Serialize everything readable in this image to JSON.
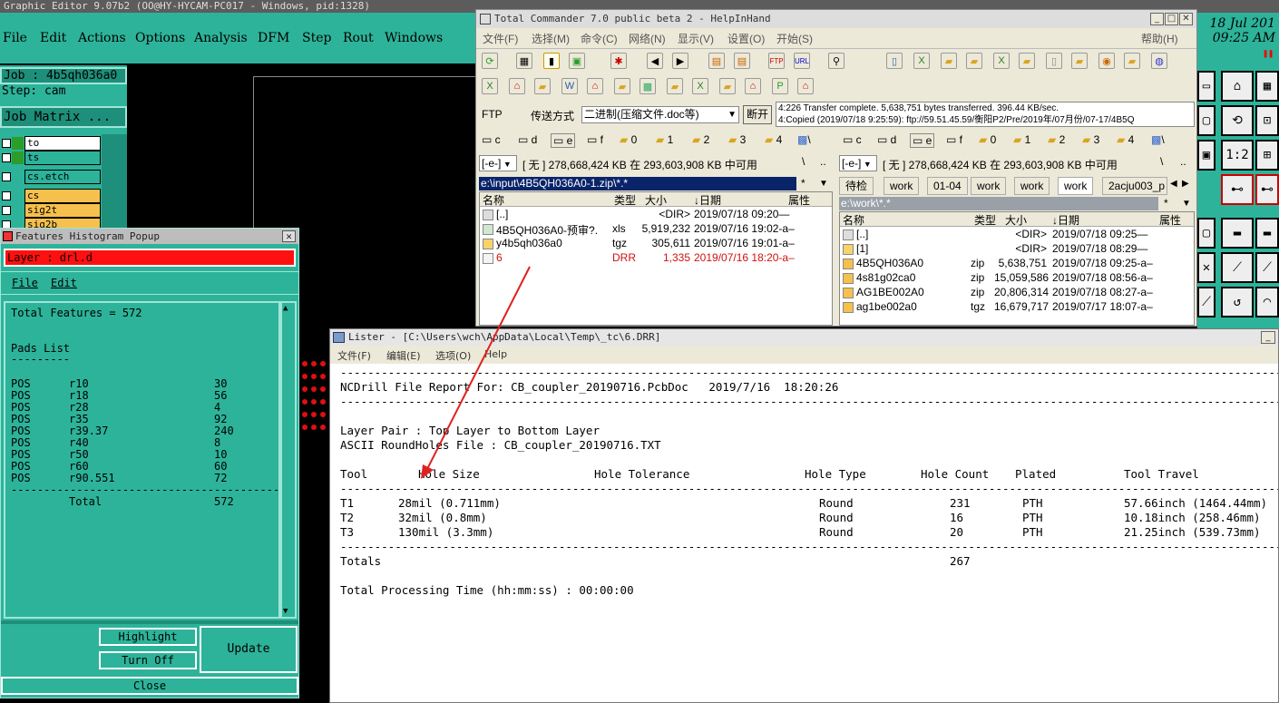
{
  "graphic_editor": {
    "title": "Graphic Editor 9.07b2 (OO@HY-HYCAM-PC017 - Windows, pid:1328)",
    "menu": [
      "File",
      "Edit",
      "Actions",
      "Options",
      "Analysis",
      "DFM",
      "Step",
      "Rout",
      "Windows"
    ],
    "job": "Job : 4b5qh036a0",
    "step": "Step: cam",
    "job_matrix": "Job Matrix ...",
    "layers": [
      {
        "name": "to",
        "color": "#ffffff",
        "swatch": "#2a9d2a"
      },
      {
        "name": "ts",
        "color": "#2db39a",
        "swatch": "#2a9d2a"
      },
      {
        "name": "cs.etch",
        "color": "#2db39a",
        "swatch": "#2db39a"
      },
      {
        "name": "cs",
        "color": "#f6c04c",
        "swatch": "#2db39a"
      },
      {
        "name": "sig2t",
        "color": "#f6c04c",
        "swatch": "#2db39a"
      },
      {
        "name": "sig2b",
        "color": "#f6c04c",
        "swatch": "#2db39a"
      }
    ],
    "date": "18 Jul 201",
    "time": "09:25 AM",
    "toolbar_labels": [
      "1:2"
    ]
  },
  "histogram": {
    "title": "Features Histogram Popup",
    "layer": "Layer :  drl.d",
    "menu": [
      "File",
      "Edit"
    ],
    "total": "Total Features = 572",
    "pads_heading": "Pads List",
    "pads_underline": "---------",
    "pads": [
      {
        "type": "POS",
        "sym": "r10",
        "count": "30"
      },
      {
        "type": "POS",
        "sym": "r18",
        "count": "56"
      },
      {
        "type": "POS",
        "sym": "r28",
        "count": "4"
      },
      {
        "type": "POS",
        "sym": "r35",
        "count": "92"
      },
      {
        "type": "POS",
        "sym": "r39.37",
        "count": "240"
      },
      {
        "type": "POS",
        "sym": "r40",
        "count": "8"
      },
      {
        "type": "POS",
        "sym": "r50",
        "count": "10"
      },
      {
        "type": "POS",
        "sym": "r60",
        "count": "60"
      },
      {
        "type": "POS",
        "sym": "r90.551",
        "count": "72"
      }
    ],
    "separator": "-----------------------------------------",
    "total_label": "Total",
    "total_value": "572",
    "buttons": {
      "highlight": "Highlight",
      "turn_off": "Turn Off",
      "update": "Update",
      "close": "Close"
    }
  },
  "total_commander": {
    "title": "Total Commander 7.0 public beta 2 - HelpInHand",
    "menu": [
      "文件(F)",
      "选择(M)",
      "命令(C)",
      "网络(N)",
      "显示(V)",
      "设置(O)",
      "开始(S)"
    ],
    "help": "帮助(H)",
    "ftp_label": "FTP",
    "transfer_mode_label": "传送方式",
    "transfer_mode_value": "二进制(压缩文件.doc等)",
    "disconnect": "断开",
    "log": [
      "4:226 Transfer complete. 5,638,751 bytes transferred. 396.44 KB/sec.",
      "4:Copied (2019/07/18 9:25:59): ftp://59.51.45.59/衡阳P2/Pre/2019年/07月份/07-17/4B5Q"
    ],
    "drives": [
      "c",
      "d",
      "e",
      "f",
      "0",
      "1",
      "2",
      "3",
      "4",
      "\\"
    ],
    "left": {
      "drive": "[-e-]",
      "info": "[ 无 ]  278,668,424 KB 在 293,603,908 KB 中可用",
      "path": "e:\\input\\4B5QH036A0-1.zip\\*.*",
      "columns": {
        "name": "名称",
        "type": "类型",
        "size": "大小",
        "date": "↓日期",
        "attr": "属性"
      },
      "files": [
        {
          "name": "[..]",
          "type": "",
          "size": "<DIR>",
          "date": "2019/07/18 09:20—",
          "red": false
        },
        {
          "name": "4B5QH036A0-预审?.",
          "type": "xls",
          "size": "5,919,232",
          "date": "2019/07/16 19:02-a–",
          "red": false
        },
        {
          "name": "y4b5qh036a0",
          "type": "tgz",
          "size": "305,611",
          "date": "2019/07/16 19:01-a–",
          "red": false
        },
        {
          "name": "6",
          "type": "DRR",
          "size": "1,335",
          "date": "2019/07/16 18:20-a–",
          "red": true
        }
      ]
    },
    "right": {
      "drive": "[-e-]",
      "info": "[ 无 ]  278,668,424 KB 在 293,603,908 KB 中可用",
      "tabs": [
        "待检",
        "work",
        "01-04",
        "work",
        "work",
        "work",
        "2acju003_p"
      ],
      "path": "e:\\work\\*.*",
      "columns": {
        "name": "名称",
        "type": "类型",
        "size": "大小",
        "date": "↓日期",
        "attr": "属性"
      },
      "files": [
        {
          "name": "[..]",
          "type": "",
          "size": "<DIR>",
          "date": "2019/07/18 09:25—"
        },
        {
          "name": "[1]",
          "type": "",
          "size": "<DIR>",
          "date": "2019/07/18 08:29—"
        },
        {
          "name": "4B5QH036A0",
          "type": "zip",
          "size": "5,638,751",
          "date": "2019/07/18 09:25-a–"
        },
        {
          "name": "4s81g02ca0",
          "type": "zip",
          "size": "15,059,586",
          "date": "2019/07/18 08:56-a–"
        },
        {
          "name": "AG1BE002A0",
          "type": "zip",
          "size": "20,806,314",
          "date": "2019/07/18 08:27-a–"
        },
        {
          "name": "ag1be002a0",
          "type": "tgz",
          "size": "16,679,717",
          "date": "2019/07/17 18:07-a–"
        }
      ]
    }
  },
  "lister": {
    "title": "Lister - [C:\\Users\\wch\\AppData\\Local\\Temp\\_tc\\6.DRR]",
    "menu": [
      "文件(F)",
      "编辑(E)",
      "选项(O)",
      "Help"
    ],
    "report_line": "NCDrill File Report For: CB_coupler_20190716.PcbDoc   2019/7/16  18:20:26",
    "layer_pair": "Layer Pair : Top Layer to Bottom Layer",
    "ascii_file": "ASCII RoundHoles File : CB_coupler_20190716.TXT",
    "columns": {
      "tool": "Tool",
      "hole_size": "Hole Size",
      "tolerance": "Hole Tolerance",
      "hole_type": "Hole Type",
      "hole_count": "Hole Count",
      "plated": "Plated",
      "travel": "Tool Travel"
    },
    "tools": [
      {
        "tool": "T1",
        "size": "28mil (0.711mm)",
        "type": "Round",
        "count": "231",
        "plated": "PTH",
        "travel": "57.66inch (1464.44mm)"
      },
      {
        "tool": "T2",
        "size": "32mil (0.8mm)",
        "type": "Round",
        "count": "16",
        "plated": "PTH",
        "travel": "10.18inch (258.46mm)"
      },
      {
        "tool": "T3",
        "size": "130mil (3.3mm)",
        "type": "Round",
        "count": "20",
        "plated": "PTH",
        "travel": "21.25inch (539.73mm)"
      }
    ],
    "totals_label": "Totals",
    "totals_value": "267",
    "processing": "Total Processing Time (hh:mm:ss) : 00:00:00",
    "dash_line": "------------------------------------------------------------------------------------------------------------------------------------------------------------"
  }
}
